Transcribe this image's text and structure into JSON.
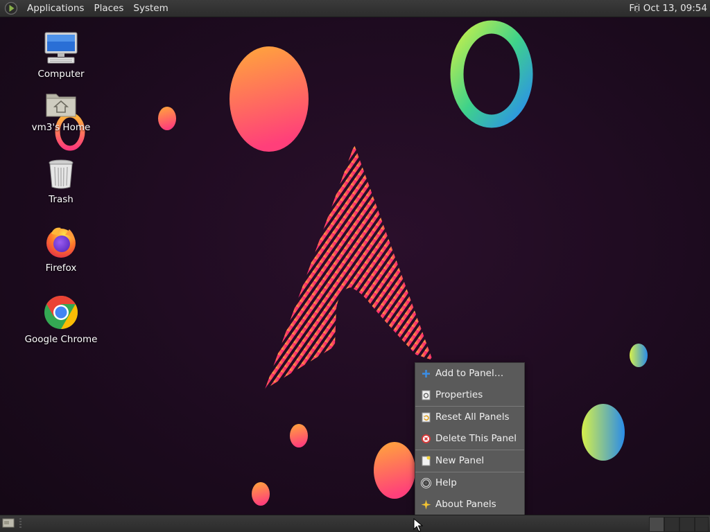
{
  "top_panel": {
    "menus": [
      "Applications",
      "Places",
      "System"
    ],
    "clock": "Fri Oct 13, 09:54"
  },
  "desktop_icons": [
    {
      "label": "Computer",
      "icon": "computer-icon"
    },
    {
      "label": "vm3's Home",
      "icon": "home-folder-icon"
    },
    {
      "label": "Trash",
      "icon": "trash-icon"
    },
    {
      "label": "Firefox",
      "icon": "firefox-icon"
    },
    {
      "label": "Google Chrome",
      "icon": "chrome-icon"
    }
  ],
  "context_menu": {
    "items": [
      {
        "label": "Add to Panel…",
        "icon": "plus-icon"
      },
      {
        "label": "Properties",
        "icon": "properties-icon"
      },
      {
        "label": "Reset All Panels",
        "icon": "reset-icon"
      },
      {
        "label": "Delete This Panel",
        "icon": "delete-icon"
      },
      {
        "label": "New Panel",
        "icon": "new-panel-icon"
      },
      {
        "label": "Help",
        "icon": "help-icon"
      },
      {
        "label": "About Panels",
        "icon": "about-icon"
      }
    ]
  },
  "colors": {
    "panel": "#2f2f2f",
    "menu_bg": "#5a5a5a",
    "wallpaper": "#1d0b1f"
  }
}
